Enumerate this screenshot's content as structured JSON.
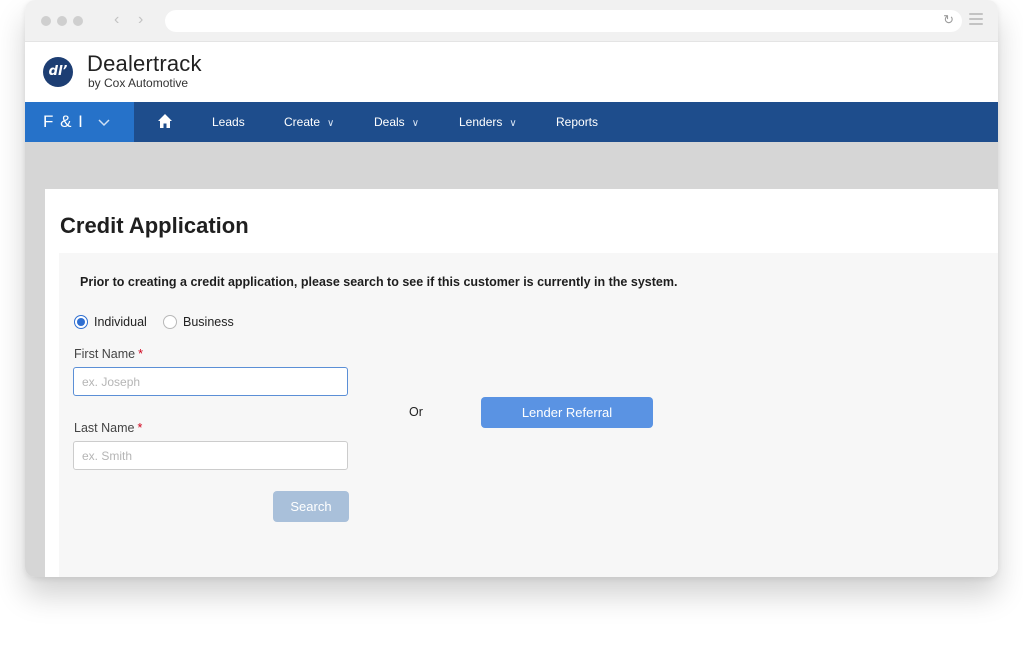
{
  "browser": {
    "back_icon": "chevron-left-icon",
    "forward_icon": "chevron-right-icon",
    "reload_icon": "reload-icon",
    "menu_icon": "hamburger-menu-icon",
    "back_glyph": "‹",
    "forward_glyph": "›",
    "reload_glyph": "↻"
  },
  "brand": {
    "logo_text": "dl’",
    "name": "Dealertrack",
    "subtitle": "by Cox Automotive"
  },
  "nav": {
    "module_label": "F & I",
    "module_caret": "⌵",
    "home_icon": "home-icon",
    "items": [
      {
        "label": "Leads",
        "has_dropdown": false
      },
      {
        "label": "Create",
        "has_dropdown": true
      },
      {
        "label": "Deals",
        "has_dropdown": true
      },
      {
        "label": "Lenders",
        "has_dropdown": true
      },
      {
        "label": "Reports",
        "has_dropdown": false
      }
    ],
    "caret_glyph": "∨"
  },
  "page": {
    "title": "Credit Application",
    "instruction": "Prior to creating a credit application, please search to see if this customer is currently in the system."
  },
  "form": {
    "customer_type": {
      "options": [
        "Individual",
        "Business"
      ],
      "selected": "Individual"
    },
    "first_name": {
      "label": "First Name",
      "required_marker": "*",
      "placeholder": "ex. Joseph",
      "value": ""
    },
    "last_name": {
      "label": "Last Name",
      "required_marker": "*",
      "placeholder": "ex. Smith",
      "value": ""
    },
    "search_label": "Search",
    "or_label": "Or",
    "lender_referral_label": "Lender Referral"
  },
  "colors": {
    "navbar": "#1e4d8c",
    "module_tab": "#2672c9",
    "primary_button": "#5a93e3",
    "disabled_button": "#a9c0da",
    "required": "#d0021b"
  }
}
